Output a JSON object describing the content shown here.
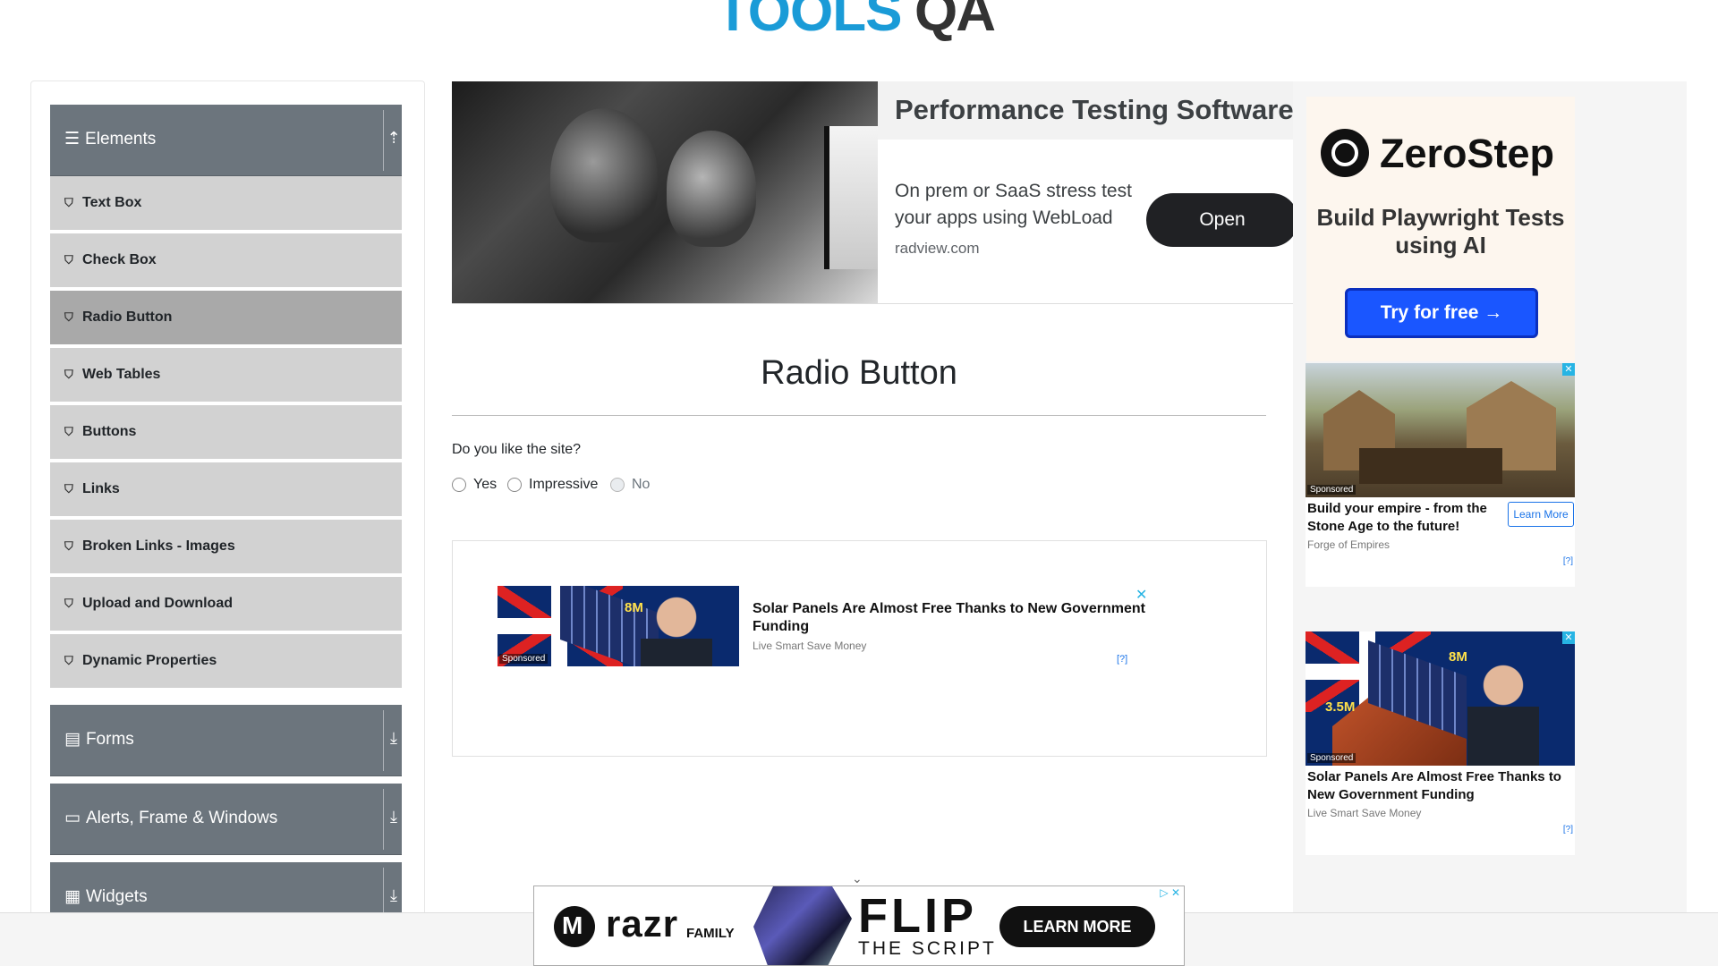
{
  "header": {
    "logo_left": "TOOLS",
    "logo_right": "QA"
  },
  "sidebar": {
    "groups": [
      {
        "label": "Elements",
        "icon": "hamburger-icon",
        "toggle_icon": "arrow-up-icon"
      },
      {
        "label": "Forms",
        "icon": "form-icon",
        "toggle_icon": "download-arrow-icon"
      },
      {
        "label": "Alerts, Frame & Windows",
        "icon": "window-icon",
        "toggle_icon": "download-arrow-icon"
      },
      {
        "label": "Widgets",
        "icon": "widgets-icon",
        "toggle_icon": "download-arrow-icon"
      }
    ],
    "items": [
      {
        "label": "Text Box"
      },
      {
        "label": "Check Box"
      },
      {
        "label": "Radio Button",
        "active": true
      },
      {
        "label": "Web Tables"
      },
      {
        "label": "Buttons"
      },
      {
        "label": "Links"
      },
      {
        "label": "Broken Links - Images"
      },
      {
        "label": "Upload and Download"
      },
      {
        "label": "Dynamic Properties"
      }
    ]
  },
  "top_ad": {
    "title": "Performance Testing Software",
    "description": "On prem or SaaS stress test your apps using WebLoad",
    "domain": "radview.com",
    "button": "Open"
  },
  "main": {
    "title": "Radio Button",
    "question": "Do you like the site?",
    "options": [
      {
        "label": "Yes",
        "selected": false,
        "disabled": false
      },
      {
        "label": "Impressive",
        "selected": false,
        "disabled": false
      },
      {
        "label": "No",
        "selected": false,
        "disabled": true
      }
    ]
  },
  "mid_ad": {
    "headline": "Solar Panels Are Almost Free Thanks to New Government Funding",
    "source": "Live Smart Save Money",
    "sponsored": "Sponsored",
    "num1": "8M",
    "adchoice": "[?]",
    "close": "✕"
  },
  "right_ads": {
    "zerostep": {
      "brand": "ZeroStep",
      "tagline": "Build Playwright Tests using AI",
      "cta": "Try for free →"
    },
    "native1": {
      "headline": "Build your empire - from the Stone Age to the future!",
      "source": "Forge of Empires",
      "learn": "Learn More",
      "sponsored": "Sponsored",
      "adchoice": "[?]",
      "close": "✕"
    },
    "native2": {
      "headline": "Solar Panels Are Almost Free Thanks to New Government Funding",
      "source": "Live Smart Save Money",
      "sponsored": "Sponsored",
      "num1": "8M",
      "num2": "3.5M",
      "adchoice": "[?]",
      "close": "✕"
    }
  },
  "bottom_ad": {
    "brand": "razr",
    "family": "FAMILY",
    "headline": "FLIP",
    "subline": "THE SCRIPT",
    "button": "LEARN MORE",
    "choices": "▷ ✕",
    "chevron": "⌄"
  },
  "colors": {
    "sidebar_header": "#6c757d",
    "menu_item": "#d2d2d2",
    "menu_item_active": "#a9a9a9",
    "logo_blue": "#1a9bd7"
  }
}
